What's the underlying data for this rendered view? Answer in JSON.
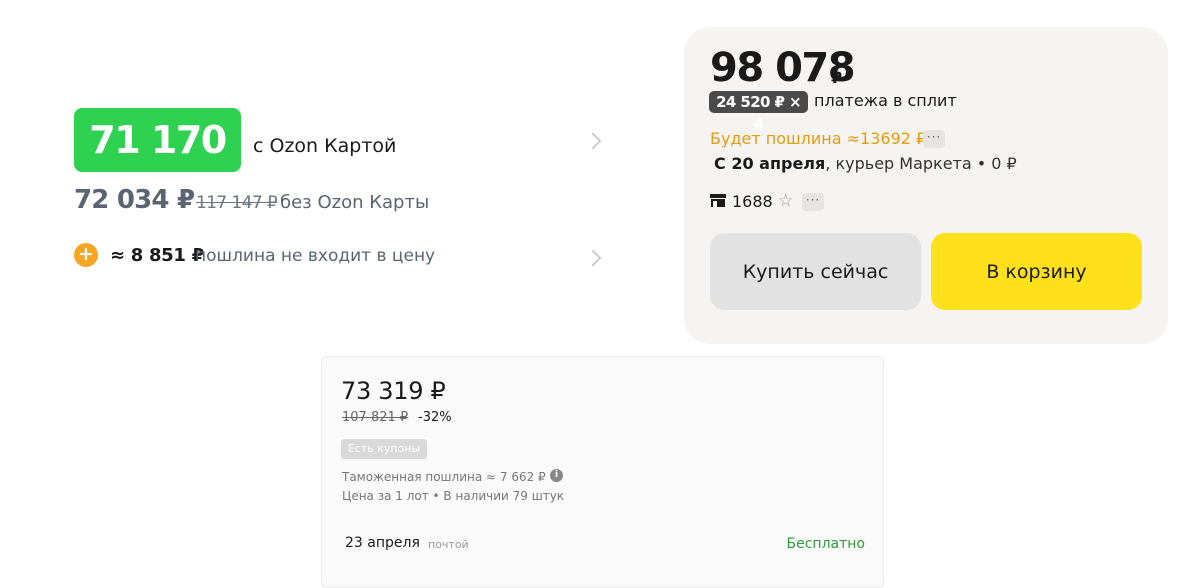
{
  "ozon": {
    "card_price": "71 170 ₽",
    "card_label": "с Ozon Картой",
    "no_card_price": "72 034 ₽",
    "old_price": "117 147 ₽",
    "no_card_label": "без Ozon Карты",
    "duty_amount": "≈ 8 851 ₽",
    "duty_label": "пошлина не входит в цену"
  },
  "yandex_market": {
    "price": "98 078",
    "currency": "₽",
    "split_amount": "24 520 ₽ × 4",
    "split_label": "платежа в сплит",
    "duty": "Будет пошлина ≈13692 ₽",
    "delivery_date": "С 20 апреля",
    "delivery_rest": ", курьер Маркета • 0 ₽",
    "shop_number": "1688",
    "buy_now": "Купить сейчас",
    "add_to_cart": "В корзину",
    "accent_color": "#ffe11b"
  },
  "aliexpress": {
    "price": "73 319 ₽",
    "old_price": "107 821 ₽",
    "discount": "-32%",
    "coupons": "Есть купоны",
    "duty": "Таможенная пошлина ≈ 7 662 ₽",
    "stock": "Цена за 1 лот • В наличии 79 штук",
    "delivery_date": "23 апреля",
    "delivery_method": "почтой",
    "delivery_price": "Бесплатно"
  },
  "icons": [
    "plus-icon",
    "chevron-right-icon",
    "more-dots-icon",
    "shop-icon",
    "star-icon",
    "info-icon"
  ],
  "colors": {
    "ozon_green": "#2fd150",
    "duty_orange": "#e49b0f",
    "free_green": "#2e9b3e"
  }
}
